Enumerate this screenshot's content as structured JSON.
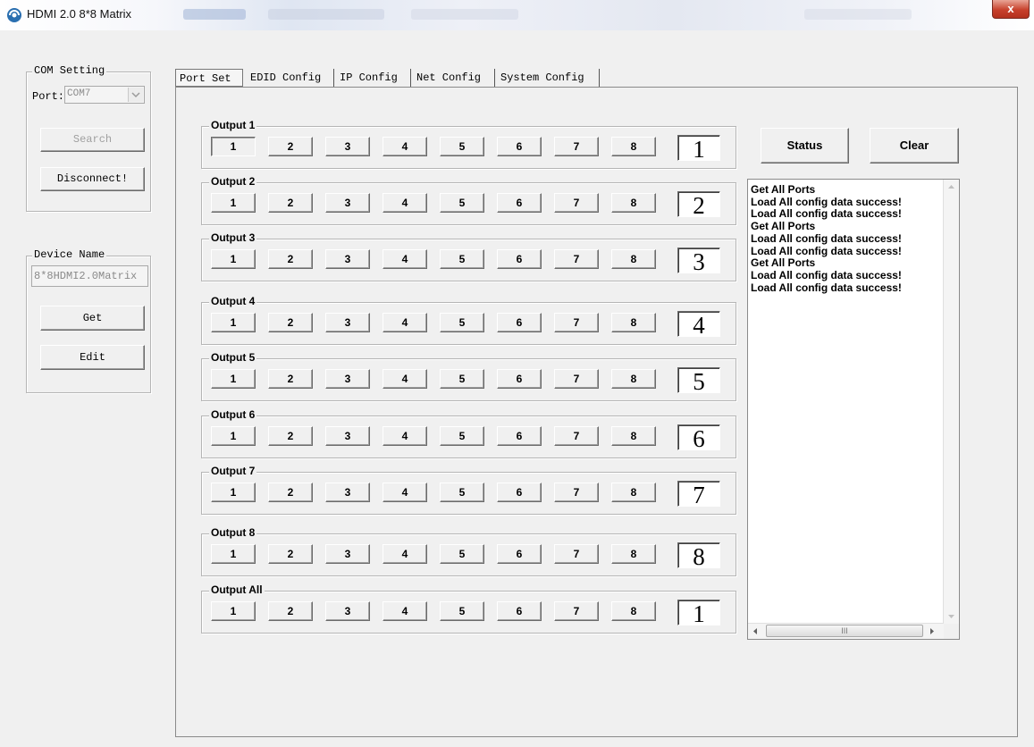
{
  "window": {
    "title": "HDMI 2.0 8*8 Matrix",
    "close_label": "x"
  },
  "com_setting": {
    "legend": "COM Setting",
    "port_label": "Port:",
    "port_value": "COM7",
    "search_label": "Search",
    "disconnect_label": "Disconnect!"
  },
  "device_name": {
    "legend": "Device Name",
    "value": "8*8HDMI2.0Matrix",
    "get_label": "Get",
    "edit_label": "Edit"
  },
  "tabs": [
    {
      "label": "Port Set",
      "active": true
    },
    {
      "label": "EDID Config",
      "active": false
    },
    {
      "label": "IP Config",
      "active": false
    },
    {
      "label": "Net Config",
      "active": false
    },
    {
      "label": "System Config",
      "active": false
    }
  ],
  "outputs": [
    {
      "label": "Output 1",
      "selected": "1"
    },
    {
      "label": "Output 2",
      "selected": "2"
    },
    {
      "label": "Output 3",
      "selected": "3"
    },
    {
      "label": "Output 4",
      "selected": "4"
    },
    {
      "label": "Output 5",
      "selected": "5"
    },
    {
      "label": "Output 6",
      "selected": "6"
    },
    {
      "label": "Output 7",
      "selected": "7"
    },
    {
      "label": "Output 8",
      "selected": "8"
    },
    {
      "label": "Output All",
      "selected": "1"
    }
  ],
  "input_buttons": [
    "1",
    "2",
    "3",
    "4",
    "5",
    "6",
    "7",
    "8"
  ],
  "status_label": "Status",
  "clear_label": "Clear",
  "log_lines": [
    "Get All Ports",
    "Load All config data success!",
    "Load All config data success!",
    "Get All Ports",
    "Load All config data success!",
    "Load All config data success!",
    "Get All Ports",
    "Load All config data success!",
    "Load All config data success!"
  ],
  "scroll_grip": "III"
}
